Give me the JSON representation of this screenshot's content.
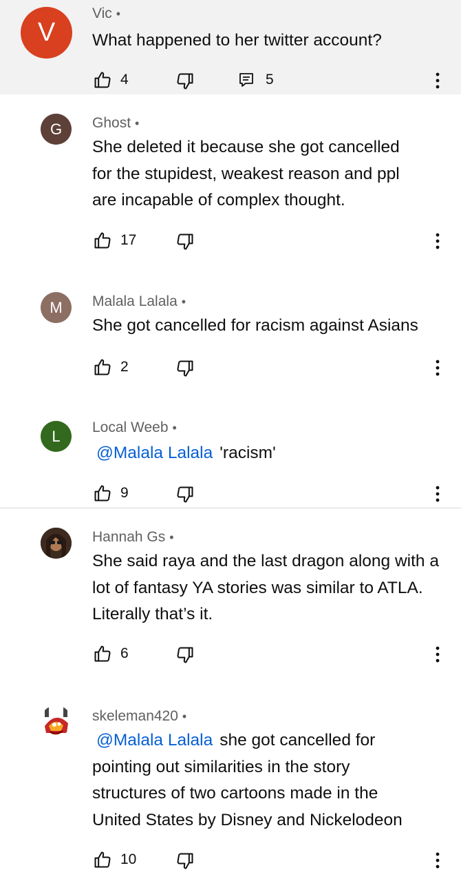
{
  "comments": [
    {
      "author": "Vic",
      "avatar_letter": "V",
      "avatar_color": "#d8401f",
      "text": "What happened to her twitter account?",
      "likes": "4",
      "replies": "5"
    },
    {
      "author": "Ghost",
      "avatar_letter": "G",
      "avatar_color": "#5d4037",
      "text": "She deleted it because she got cancelled for the stupidest, weakest reason and ppl are incapable of complex thought.",
      "likes": "17"
    },
    {
      "author": "Malala Lalala",
      "avatar_letter": "M",
      "avatar_color": "#8d6e63",
      "text": "She got cancelled for racism against Asians",
      "likes": "2"
    },
    {
      "author": "Local Weeb",
      "avatar_letter": "L",
      "avatar_color": "#33691e",
      "mention": "@Malala Lalala",
      "text": "'racism'",
      "likes": "9"
    },
    {
      "author": "Hannah Gs",
      "avatar_color": "#4a3426",
      "text": "She said raya and the last dragon along with a lot of fantasy YA stories was similar to ATLA. Literally that’s it.",
      "likes": "6"
    },
    {
      "author": "skeleman420",
      "avatar_color": "#c62828",
      "mention": "@Malala Lalala",
      "text": "she got cancelled for pointing out similarities in the story structures of two cartoons made in the United States by Disney and Nickelodeon",
      "likes": "10"
    }
  ],
  "separator": "•",
  "colors": {
    "link": "#065fd4",
    "meta": "#606060",
    "highlight_bg": "#f2f2f2"
  },
  "icons": [
    "thumbs-up-icon",
    "thumbs-down-icon",
    "reply-icon",
    "more-vert-icon"
  ]
}
